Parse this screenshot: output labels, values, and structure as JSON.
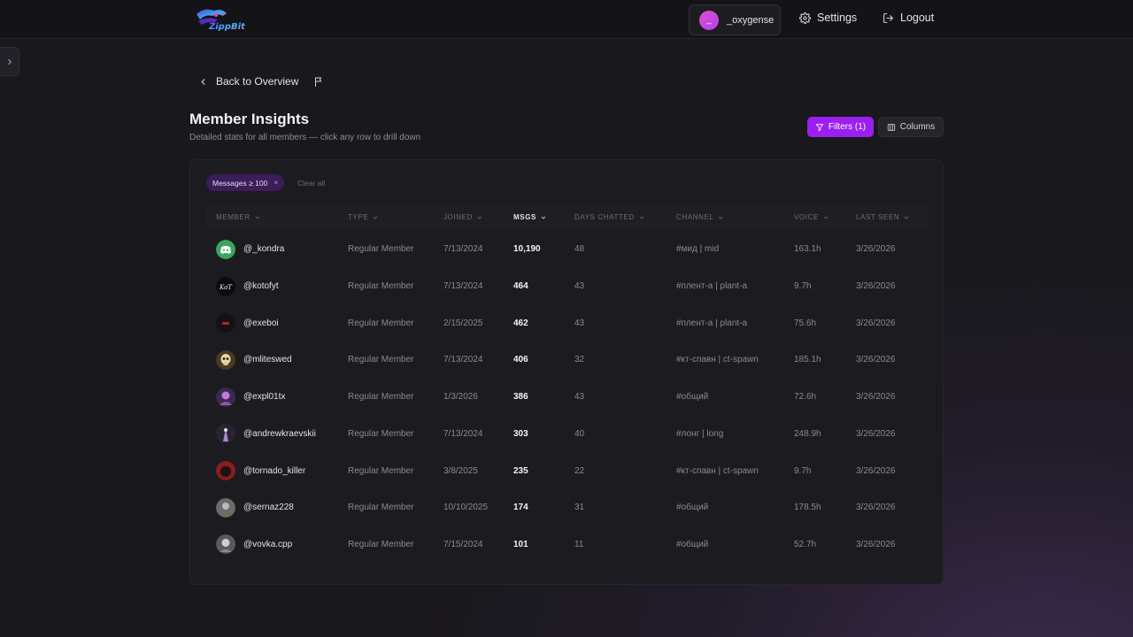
{
  "header": {
    "user_name": "_oxygense",
    "user_initial": "_",
    "settings_label": "Settings",
    "logout_label": "Logout"
  },
  "nav": {
    "back_label": "Back to Overview"
  },
  "page": {
    "title": "Member Insights",
    "subtitle": "Detailed stats for all members — click any row to drill down"
  },
  "toolbar": {
    "filters_label": "Filters (1)",
    "columns_label": "Columns"
  },
  "filter_chip": {
    "label": "Messages ≥ 100",
    "remove": "×",
    "clear_all": "Clear all"
  },
  "table": {
    "columns": [
      "MEMBER",
      "TYPE",
      "JOINED",
      "MSGS",
      "DAYS CHATTED",
      "CHANNEL",
      "VOICE",
      "LAST SEEN"
    ],
    "sorted_column": "MSGS",
    "rows": [
      {
        "member": "@_kondra",
        "type": "Regular Member",
        "joined": "7/13/2024",
        "msgs": "10,190",
        "days": "48",
        "channel": "#мид | mid",
        "voice": "163.1h",
        "last_seen": "3/26/2026",
        "avatar": "discord-green"
      },
      {
        "member": "@kotofyt",
        "type": "Regular Member",
        "joined": "7/13/2024",
        "msgs": "464",
        "days": "43",
        "channel": "#плент-а | plant-a",
        "voice": "9.7h",
        "last_seen": "3/26/2026",
        "avatar": "kot-black"
      },
      {
        "member": "@exeboi",
        "type": "Regular Member",
        "joined": "2/15/2025",
        "msgs": "462",
        "days": "43",
        "channel": "#плент-а | plant-a",
        "voice": "75.6h",
        "last_seen": "3/26/2026",
        "avatar": "dark-red"
      },
      {
        "member": "@mliteswed",
        "type": "Regular Member",
        "joined": "7/13/2024",
        "msgs": "406",
        "days": "32",
        "channel": "#кт-спавн | ct-spawn",
        "voice": "185.1h",
        "last_seen": "3/26/2026",
        "avatar": "skull-gold"
      },
      {
        "member": "@expl01tx",
        "type": "Regular Member",
        "joined": "1/3/2026",
        "msgs": "386",
        "days": "43",
        "channel": "#общий",
        "voice": "72.6h",
        "last_seen": "3/26/2026",
        "avatar": "purple-character"
      },
      {
        "member": "@andrewkraevskii",
        "type": "Regular Member",
        "joined": "7/13/2024",
        "msgs": "303",
        "days": "40",
        "channel": "#лонг | long",
        "voice": "248.9h",
        "last_seen": "3/26/2026",
        "avatar": "violet-figure"
      },
      {
        "member": "@tornado_killer",
        "type": "Regular Member",
        "joined": "3/8/2025",
        "msgs": "235",
        "days": "22",
        "channel": "#кт-спавн | ct-spawn",
        "voice": "9.7h",
        "last_seen": "3/26/2026",
        "avatar": "red-dark"
      },
      {
        "member": "@sernaz228",
        "type": "Regular Member",
        "joined": "10/10/2025",
        "msgs": "174",
        "days": "31",
        "channel": "#общий",
        "voice": "178.5h",
        "last_seen": "3/26/2026",
        "avatar": "grey-green"
      },
      {
        "member": "@vovka.cpp",
        "type": "Regular Member",
        "joined": "7/15/2024",
        "msgs": "101",
        "days": "11",
        "channel": "#общий",
        "voice": "52.7h",
        "last_seen": "3/26/2026",
        "avatar": "grey-face"
      }
    ]
  },
  "colors": {
    "accent": "#9b1ff0",
    "chip_bg": "#3b1d58",
    "background": "#19181c",
    "card": "#1c1b20"
  },
  "icons": {
    "settings": "gear-icon",
    "logout": "logout-icon",
    "back": "chevron-left-icon",
    "flag": "flag-icon",
    "filter": "filter-icon",
    "columns": "columns-icon",
    "sort": "chevron-down-icon",
    "sidebar": "chevron-right-icon"
  }
}
